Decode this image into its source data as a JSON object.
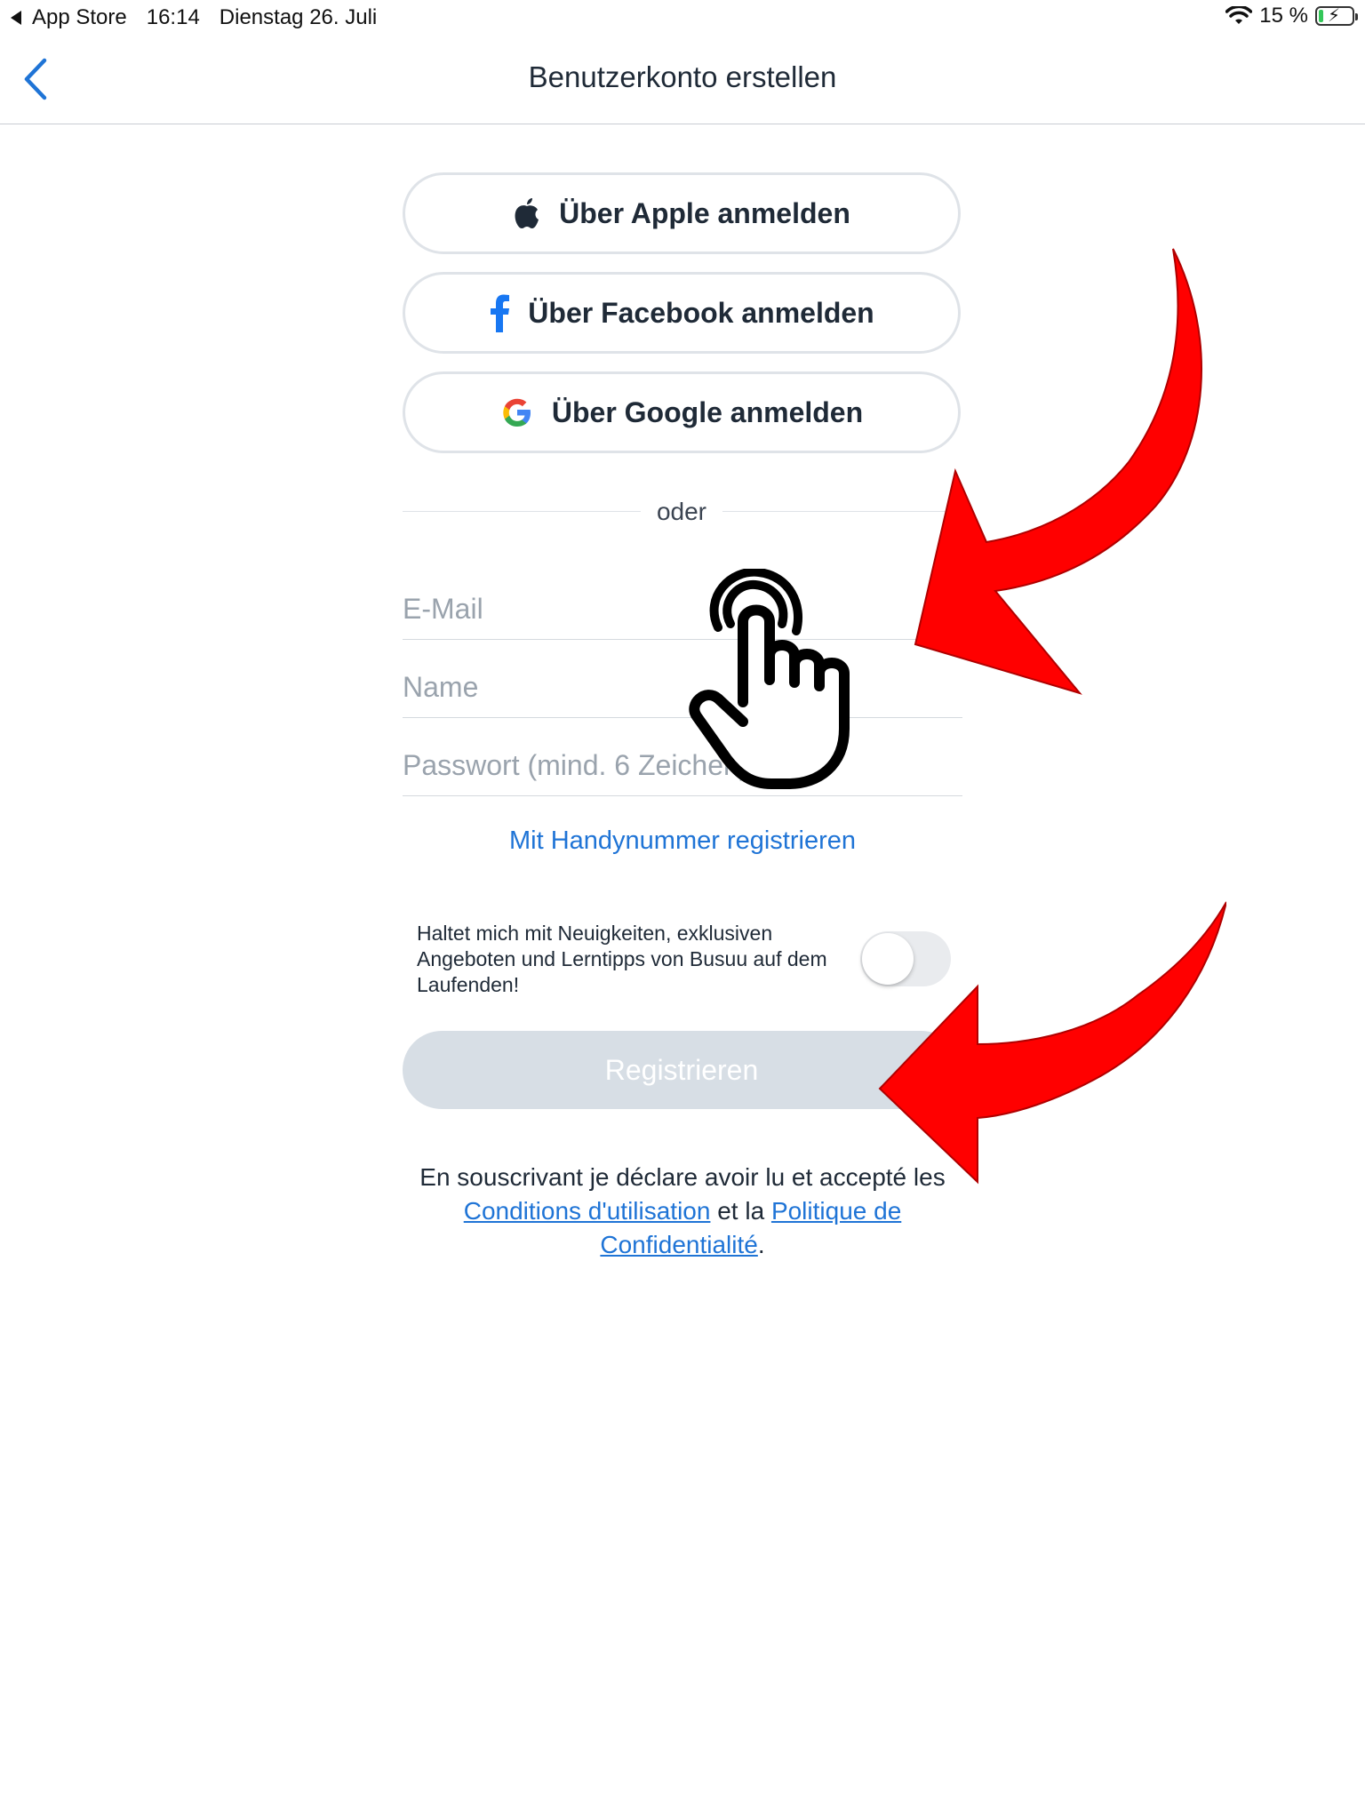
{
  "status_bar": {
    "back_app": "App Store",
    "time": "16:14",
    "date": "Dienstag 26. Juli",
    "battery": "15 %",
    "battery_level": 0.15
  },
  "nav": {
    "title": "Benutzerkonto erstellen",
    "back_icon": "chevron-left-icon"
  },
  "social": {
    "apple": {
      "label": "Über Apple anmelden",
      "icon": "apple-icon"
    },
    "facebook": {
      "label": "Über Facebook anmelden",
      "icon": "facebook-icon"
    },
    "google": {
      "label": "Über Google anmelden",
      "icon": "google-icon"
    }
  },
  "divider_text": "oder",
  "form": {
    "email_placeholder": "E-Mail",
    "name_placeholder": "Name",
    "password_placeholder": "Passwort (mind. 6 Zeichen)"
  },
  "phone_link": "Mit Handynummer registrieren",
  "newsletter": {
    "text": "Haltet mich mit Neuigkeiten, exklusiven Angeboten und Lerntipps von Busuu auf dem Laufenden!",
    "enabled": false
  },
  "register_button": "Registrieren",
  "terms": {
    "part1": "En souscrivant je déclare avoir lu et accepté les ",
    "conditions_link": "Conditions d'utilisation",
    "part2": " et la ",
    "privacy_link": "Politique de Confidentialité",
    "part3": "."
  },
  "colors": {
    "accent": "#1f74d6",
    "annotation_arrow": "#ff0000",
    "disabled_button": "#d7dee5",
    "battery_green": "#34c759"
  }
}
